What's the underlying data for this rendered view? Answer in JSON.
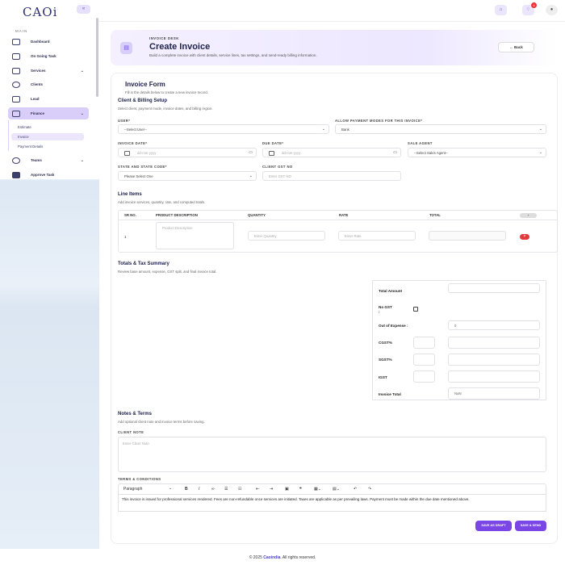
{
  "brand": {
    "logo": "CAOi",
    "collapse_glyph": "«"
  },
  "sidebar": {
    "section_title": "MAIN",
    "items": [
      {
        "label": "Dashboard"
      },
      {
        "label": "On Going Task"
      },
      {
        "label": "Services"
      },
      {
        "label": "Clients"
      },
      {
        "label": "Lead"
      },
      {
        "label": "Finance"
      },
      {
        "label": "Teams"
      },
      {
        "label": "Approve Task"
      }
    ],
    "finance_sub": [
      "Estimate",
      "Invoice",
      "Payment Details"
    ]
  },
  "topbar": {
    "notification_count": "4"
  },
  "header": {
    "kicker": "INVOICE DESK",
    "title": "Create Invoice",
    "subtitle": "Build a complete invoice with client details, service lines, tax settings, and send-ready billing information.",
    "back": "← Back"
  },
  "form": {
    "title": "Invoice Form",
    "subtitle": "Fill in the details below to create a new invoice record.",
    "client_section": "Client & Billing Setup",
    "client_section_sub": "Select client, payment mode, invoice dates, and billing region.",
    "user_label": "USER*",
    "user_value": "--Select User--",
    "payment_label": "ALLOW PAYMENT MODES FOR THIS INVOICE*",
    "payment_value": "Bank",
    "invoice_date_label": "INVOICE DATE*",
    "invoice_date_ph": "dd-mm-yyyy",
    "due_date_label": "DUE DATE*",
    "due_date_ph": "dd-mm-yyyy",
    "agent_label": "SALE AGENT",
    "agent_value": "--Select Sales Agent--",
    "state_label": "STATE AND STATE CODE*",
    "state_value": "Please Select One",
    "gst_label": "CLIENT GST NO",
    "gst_ph": "Enter GST NO"
  },
  "line_items": {
    "title": "Line Items",
    "subtitle": "Add invoice services, quantity, rate, and computed totals.",
    "headers": [
      "SR NO.",
      "PRODUCT DESCRIPTION",
      "QUANTITY",
      "RATE",
      "TOTAL"
    ],
    "add": "+",
    "row": {
      "sr": "1",
      "desc_ph": "Product Description",
      "qty_ph": "Enter Quantity",
      "rate_ph": "Enter Rate",
      "delete": "×"
    }
  },
  "totals": {
    "title": "Totals & Tax Summary",
    "subtitle": "Review base amount, expense, GST split, and final invoice total.",
    "total_amount": "Total Amount",
    "no_gst": "No GST",
    "no_gst_colon": ":",
    "expense": "Out of Expense :",
    "expense_value": "0",
    "cgst": "CGST%",
    "sgst": "SGST%",
    "igst": "IGST",
    "invoice_total": "Invoice Total",
    "invoice_total_value": "NaN"
  },
  "notes": {
    "title": "Notes & Terms",
    "subtitle": "Add optional client note and invoice terms before saving.",
    "client_note_label": "CLIENT NOTE",
    "client_note_ph": "Enter Client Note",
    "terms_label": "TERMS & CONDITIONS",
    "paragraph": "Paragraph",
    "terms_text": "This invoice is issued for professional services rendered. Fees are non-refundable once services are initiated. Taxes are applicable as per prevailing laws. Payment must be made within the due date mentioned above."
  },
  "actions": {
    "draft": "SAVE AS DRAFT",
    "send": "SAVE & SEND"
  },
  "footer": {
    "prefix": "© 2025 ",
    "brand": "Caoindia",
    "suffix": ". All rights reserved."
  },
  "colors": {
    "accent": "#7b46e6",
    "danger": "#e23b3b",
    "active_nav": "#d9cef9"
  }
}
